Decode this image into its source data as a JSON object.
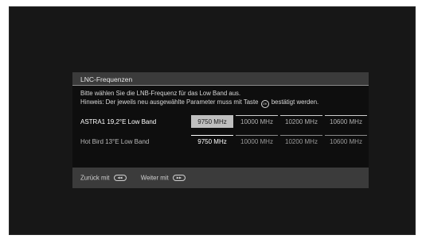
{
  "dialog": {
    "title": "LNC-Frequenzen",
    "hint_line1": "Bitte wählen Sie die LNB-Frequenz für das Low Band aus.",
    "hint_line2_before": "Hinweis: Der jeweils neu ausgewählte Parameter muss mit Taste",
    "hint_line2_after": "bestätigt werden.",
    "ok_icon_text": "OK"
  },
  "rows": [
    {
      "label": "ASTRA1 19,2°E Low Band",
      "options": [
        "9750 MHz",
        "10000 MHz",
        "10200 MHz",
        "10600 MHz"
      ],
      "selected": "9750 MHz",
      "focused": true
    },
    {
      "label": "Hot Bird 13°E Low Band",
      "options": [
        "9750 MHz",
        "10000 MHz",
        "10200 MHz",
        "10600 MHz"
      ],
      "selected": "9750 MHz",
      "focused": false
    }
  ],
  "footer": {
    "back_label": "Zurück mit",
    "back_icon": "rewind-key-icon",
    "next_label": "Weiter mit",
    "next_icon": "fast-forward-key-icon",
    "back_key_text": "◀◀",
    "next_key_text": "▶▶"
  },
  "colors": {
    "screen_bg": "#171717",
    "dialog_bg": "#3b3b3b",
    "content_bg": "#0e0e0e",
    "focus_highlight": "#bfbfbf"
  }
}
